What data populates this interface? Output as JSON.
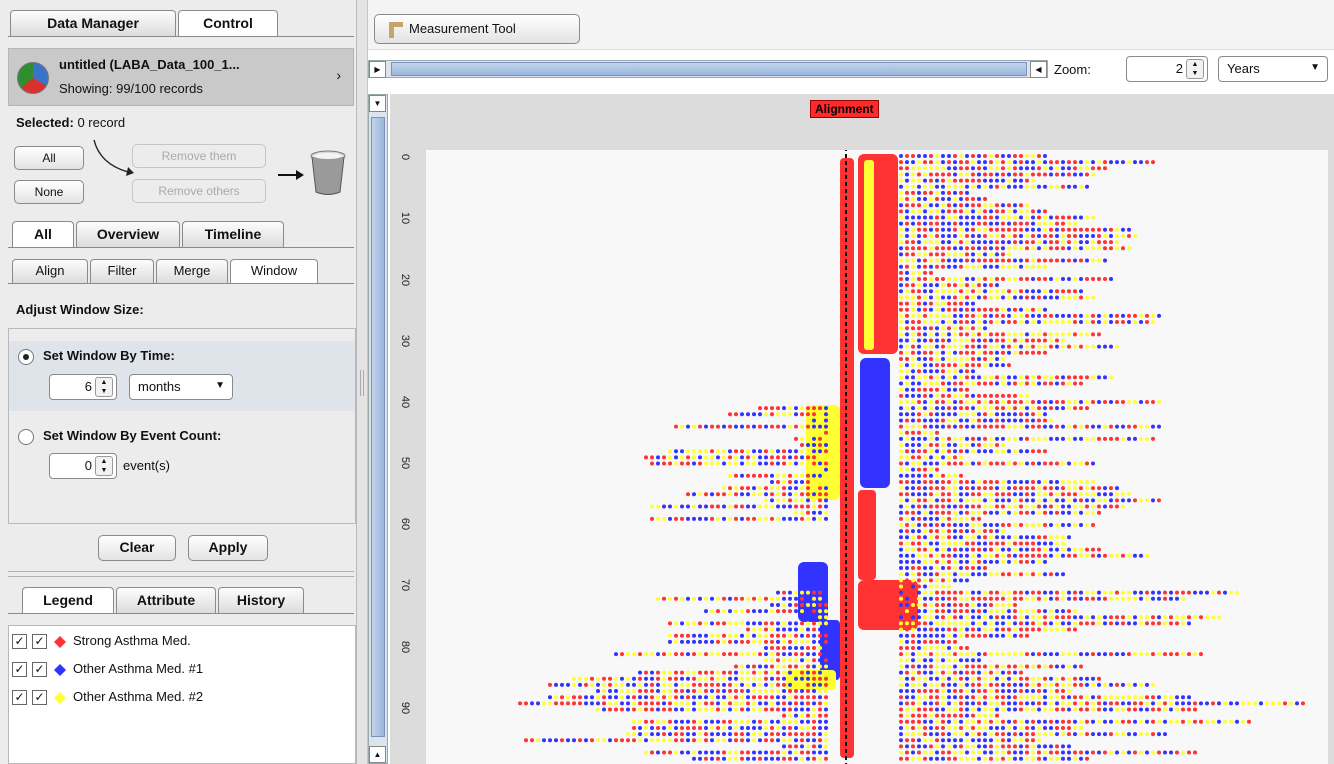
{
  "main_tabs": [
    "Data Manager",
    "Control"
  ],
  "dataset": {
    "title": "untitled (LABA_Data_100_1...",
    "showing": "Showing: 99/100 records",
    "chevron": "›"
  },
  "selection": {
    "label": "Selected:",
    "value": "0 record",
    "all": "All",
    "none": "None",
    "remove_them": "Remove them",
    "remove_others": "Remove others"
  },
  "view_tabs": [
    "All",
    "Overview",
    "Timeline"
  ],
  "op_tabs": [
    "Align",
    "Filter",
    "Merge",
    "Window"
  ],
  "window": {
    "heading": "Adjust Window Size:",
    "by_time": "Set Window By Time:",
    "time_value": "6",
    "time_unit": "months",
    "by_count": "Set Window By Event Count:",
    "count_value": "0",
    "count_unit": "event(s)",
    "clear": "Clear",
    "apply": "Apply"
  },
  "bottom_tabs": [
    "Legend",
    "Attribute",
    "History"
  ],
  "legend": [
    {
      "label": "Strong Asthma Med.",
      "color": "#ff3333"
    },
    {
      "label": "Other Asthma Med. #1",
      "color": "#3333ff"
    },
    {
      "label": "Other Asthma Med. #2",
      "color": "#ffff33"
    }
  ],
  "toolbar": {
    "measurement": "Measurement Tool"
  },
  "zoom": {
    "label": "Zoom:",
    "value": "2",
    "unit": "Years"
  },
  "plot": {
    "alignment_label": "Alignment",
    "y_ticks": [
      "0",
      "10",
      "20",
      "30",
      "40",
      "50",
      "60",
      "70",
      "80",
      "90"
    ]
  },
  "colors": {
    "strong": "#ff3333",
    "other1": "#3333ff",
    "other2": "#ffff33"
  }
}
